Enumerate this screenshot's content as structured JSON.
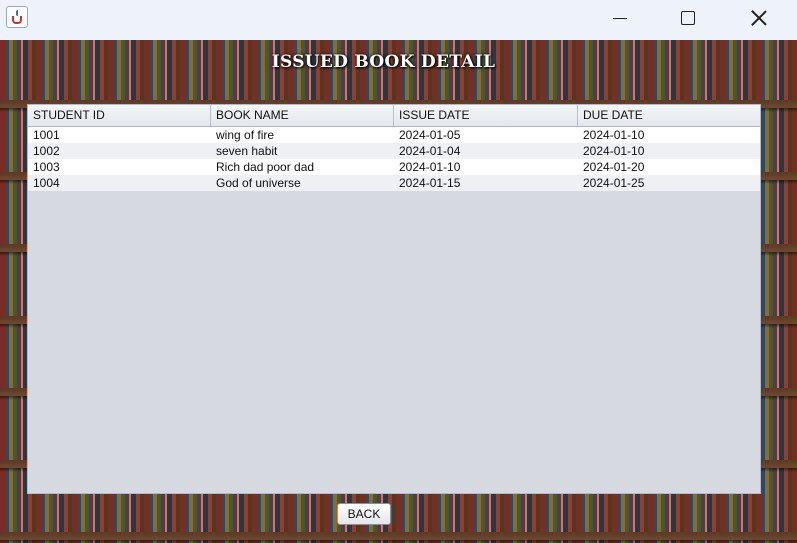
{
  "window": {
    "app_icon": "java-cup-icon",
    "controls": [
      "minimize-icon",
      "maximize-icon",
      "close-icon"
    ]
  },
  "page": {
    "title": "ISSUED BOOK DETAIL",
    "back_label": "BACK"
  },
  "table": {
    "columns": [
      "STUDENT ID",
      "BOOK NAME",
      "ISSUE DATE",
      "DUE DATE"
    ],
    "rows": [
      [
        "1001",
        "wing of fire",
        "2024-01-05",
        "2024-01-10"
      ],
      [
        "1002",
        "seven habit",
        "2024-01-04",
        "2024-01-10"
      ],
      [
        "1003",
        "Rich dad poor dad",
        "2024-01-10",
        "2024-01-20"
      ],
      [
        "1004",
        "God of universe",
        "2024-01-15",
        "2024-01-25"
      ]
    ]
  },
  "colors": {
    "title_text": "#ffffff",
    "panel_background": "#d6d9e0",
    "window_chrome": "#eef2fb"
  }
}
